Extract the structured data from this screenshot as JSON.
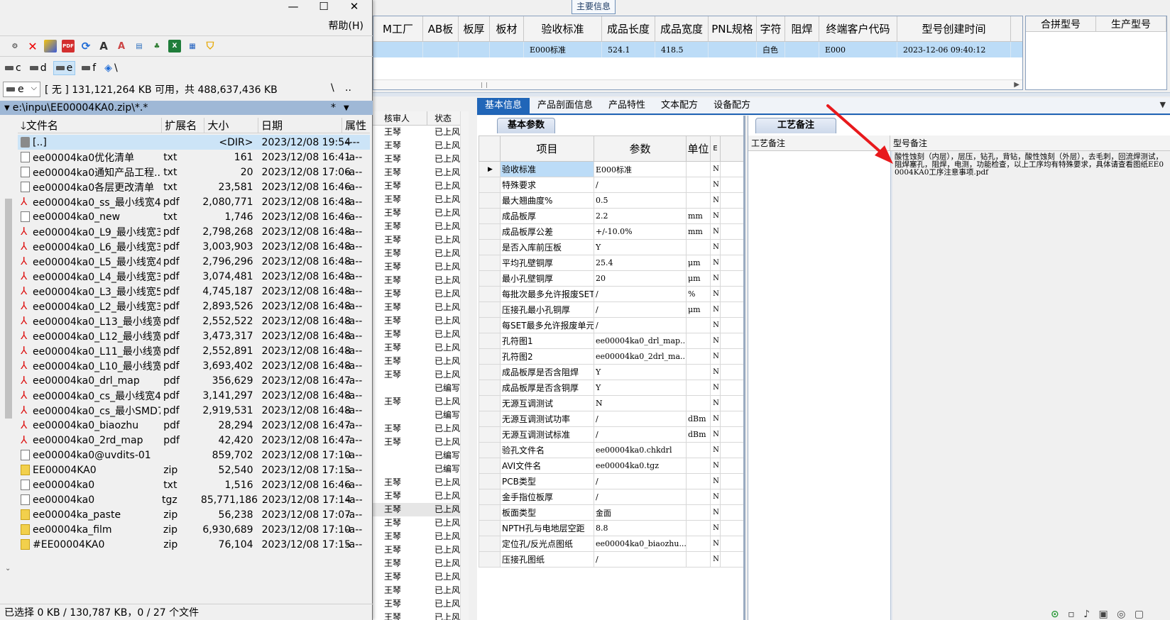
{
  "erp": {
    "main_info_tab": "主要信息",
    "top_grid": {
      "headers": [
        "M工厂",
        "AB板",
        "板厚",
        "板材",
        "验收标准",
        "成品长度",
        "成品宽度",
        "PNL规格",
        "字符",
        "阻焊",
        "终端客户代码",
        "型号创建时间"
      ],
      "row": [
        "",
        "",
        "",
        "",
        "E000标准",
        "524.1",
        "418.5",
        "",
        "白色",
        "",
        "E000",
        "2023-12-06 09:40:12"
      ]
    },
    "merge_grid": {
      "headers": [
        "合拼型号",
        "生产型号"
      ]
    },
    "reviewer_grid": {
      "headers": [
        "核审人",
        "状态"
      ],
      "rows": [
        [
          "王琴",
          "已上风"
        ],
        [
          "王琴",
          "已上风"
        ],
        [
          "王琴",
          "已上风"
        ],
        [
          "王琴",
          "已上风"
        ],
        [
          "王琴",
          "已上风"
        ],
        [
          "王琴",
          "已上风"
        ],
        [
          "王琴",
          "已上风"
        ],
        [
          "王琴",
          "已上风"
        ],
        [
          "王琴",
          "已上风"
        ],
        [
          "王琴",
          "已上风"
        ],
        [
          "王琴",
          "已上风"
        ],
        [
          "王琴",
          "已上风"
        ],
        [
          "王琴",
          "已上风"
        ],
        [
          "王琴",
          "已上风"
        ],
        [
          "王琴",
          "已上风"
        ],
        [
          "王琴",
          "已上风"
        ],
        [
          "王琴",
          "已上风"
        ],
        [
          "王琴",
          "已上风"
        ],
        [
          "王琴",
          "已上风"
        ],
        [
          "",
          "已编写"
        ],
        [
          "王琴",
          "已上风"
        ],
        [
          "",
          "已编写"
        ],
        [
          "王琴",
          "已上风"
        ],
        [
          "王琴",
          "已上风"
        ],
        [
          "",
          "已编写"
        ],
        [
          "",
          "已编写"
        ],
        [
          "王琴",
          "已上风"
        ],
        [
          "王琴",
          "已上风"
        ],
        [
          "王琴",
          "已上风"
        ],
        [
          "王琴",
          "已上风"
        ],
        [
          "王琴",
          "已上风"
        ],
        [
          "王琴",
          "已上风"
        ],
        [
          "王琴",
          "已上风"
        ],
        [
          "王琴",
          "已上风"
        ],
        [
          "王琴",
          "已上风"
        ],
        [
          "王琴",
          "已上风"
        ],
        [
          "王琴",
          "已上风"
        ]
      ]
    },
    "tabs": [
      "基本信息",
      "产品剖面信息",
      "产品特性",
      "文本配方",
      "设备配方"
    ],
    "basic_subtab": "基本参数",
    "param_headers": [
      "项目",
      "参数",
      "单位",
      "E"
    ],
    "params": [
      {
        "item": "验收标准",
        "value": "E000标准",
        "unit": "",
        "flag": "N"
      },
      {
        "item": "特殊要求",
        "value": "/",
        "unit": "",
        "flag": "N"
      },
      {
        "item": "最大翘曲度%",
        "value": "0.5",
        "unit": "",
        "flag": "N"
      },
      {
        "item": "成品板厚",
        "value": "2.2",
        "unit": "mm",
        "flag": "N"
      },
      {
        "item": "成品板厚公差",
        "value": "+/-10.0%",
        "unit": "mm",
        "flag": "N"
      },
      {
        "item": "是否入库前压板",
        "value": "Y",
        "unit": "",
        "flag": "N"
      },
      {
        "item": "平均孔壁铜厚",
        "value": "25.4",
        "unit": "μm",
        "flag": "N"
      },
      {
        "item": "最小孔壁铜厚",
        "value": "20",
        "unit": "μm",
        "flag": "N"
      },
      {
        "item": "每批次最多允许报废SET",
        "value": "/",
        "unit": "%",
        "flag": "N"
      },
      {
        "item": "压接孔最小孔铜厚",
        "value": "/",
        "unit": "μm",
        "flag": "N"
      },
      {
        "item": "每SET最多允许报废单元",
        "value": "/",
        "unit": "",
        "flag": "N"
      },
      {
        "item": "孔符图1",
        "value": "ee00004ka0_drl_map...",
        "unit": "",
        "flag": "N"
      },
      {
        "item": "孔符图2",
        "value": "ee00004ka0_2drl_ma...",
        "unit": "",
        "flag": "N"
      },
      {
        "item": "成品板厚是否含阻焊",
        "value": "Y",
        "unit": "",
        "flag": "N"
      },
      {
        "item": "成品板厚是否含铜厚",
        "value": "Y",
        "unit": "",
        "flag": "N"
      },
      {
        "item": "无源互调测试",
        "value": "N",
        "unit": "",
        "flag": "N"
      },
      {
        "item": "无源互调测试功率",
        "value": "/",
        "unit": "dBm",
        "flag": "N"
      },
      {
        "item": "无源互调测试标准",
        "value": "/",
        "unit": "dBm",
        "flag": "N"
      },
      {
        "item": "验孔文件名",
        "value": "ee00004ka0.chkdrl",
        "unit": "",
        "flag": "N"
      },
      {
        "item": "AVI文件名",
        "value": "ee00004ka0.tgz",
        "unit": "",
        "flag": "N"
      },
      {
        "item": "PCB类型",
        "value": "/",
        "unit": "",
        "flag": "N"
      },
      {
        "item": "金手指位板厚",
        "value": "/",
        "unit": "",
        "flag": "N"
      },
      {
        "item": "板面类型",
        "value": "金面",
        "unit": "",
        "flag": "N"
      },
      {
        "item": "NPTH孔与电地层空距",
        "value": "8.8",
        "unit": "",
        "flag": "N"
      },
      {
        "item": "定位孔/反光点图纸",
        "value": "ee00004ka0_biaozhu...",
        "unit": "",
        "flag": "N"
      },
      {
        "item": "压接孔图纸",
        "value": "/",
        "unit": "",
        "flag": "N"
      }
    ],
    "craft_subtab": "工艺备注",
    "craft_headers": [
      "工艺备注",
      "型号备注"
    ],
    "model_note": "酸性蚀刻（内层），层压，钻孔，背钻，酸性蚀刻（外层），去毛刺，回流焊测试，阻焊塞孔，阻焊，电测，功能检查，以上工序均有特殊要求，具体请查看图纸EE00004KA0工序注意事项.pdf",
    "arrow_color": "#e8191c"
  },
  "tc": {
    "menu_help": "帮助(H)",
    "drives": [
      "c",
      "d",
      "e",
      "f"
    ],
    "root_symbol": "\\",
    "drive_current": "e",
    "free_space": "[ 无 ]  131,121,264 KB 可用，共 488,637,436 KB",
    "nav_root": "\\",
    "nav_up": "..",
    "nav_star": "*",
    "current_path": "e:\\inpu\\EE00004KA0.zip\\*.*",
    "columns": [
      "文件名",
      "扩展名",
      "大小",
      "日期",
      "属性"
    ],
    "files": [
      {
        "name": "[..]",
        "ext": "",
        "size": "<DIR>",
        "date": "2023/12/08 19:54",
        "attr": "----",
        "icon": "up"
      },
      {
        "name": "ee00004ka0优化清单",
        "ext": "txt",
        "size": "161",
        "date": "2023/12/08 16:41",
        "attr": "-a--",
        "icon": "doc"
      },
      {
        "name": "ee00004ka0通知产品工程...",
        "ext": "txt",
        "size": "20",
        "date": "2023/12/08 17:06",
        "attr": "-a--",
        "icon": "doc"
      },
      {
        "name": "ee00004ka0各层更改清单",
        "ext": "txt",
        "size": "23,581",
        "date": "2023/12/08 16:46",
        "attr": "-a--",
        "icon": "doc"
      },
      {
        "name": "ee00004ka0_ss_最小线宽4...",
        "ext": "pdf",
        "size": "2,080,771",
        "date": "2023/12/08 16:48",
        "attr": "-a--",
        "icon": "pdf"
      },
      {
        "name": "ee00004ka0_new",
        "ext": "txt",
        "size": "1,746",
        "date": "2023/12/08 16:46",
        "attr": "-a--",
        "icon": "doc"
      },
      {
        "name": "ee00004ka0_L9_最小线宽3...",
        "ext": "pdf",
        "size": "2,798,268",
        "date": "2023/12/08 16:48",
        "attr": "-a--",
        "icon": "pdf"
      },
      {
        "name": "ee00004ka0_L6_最小线宽3...",
        "ext": "pdf",
        "size": "3,003,903",
        "date": "2023/12/08 16:48",
        "attr": "-a--",
        "icon": "pdf"
      },
      {
        "name": "ee00004ka0_L5_最小线宽4...",
        "ext": "pdf",
        "size": "2,796,296",
        "date": "2023/12/08 16:48",
        "attr": "-a--",
        "icon": "pdf"
      },
      {
        "name": "ee00004ka0_L4_最小线宽3...",
        "ext": "pdf",
        "size": "3,074,481",
        "date": "2023/12/08 16:48",
        "attr": "-a--",
        "icon": "pdf"
      },
      {
        "name": "ee00004ka0_L3_最小线宽5...",
        "ext": "pdf",
        "size": "4,745,187",
        "date": "2023/12/08 16:48",
        "attr": "-a--",
        "icon": "pdf"
      },
      {
        "name": "ee00004ka0_L2_最小线宽3...",
        "ext": "pdf",
        "size": "2,893,526",
        "date": "2023/12/08 16:48",
        "attr": "-a--",
        "icon": "pdf"
      },
      {
        "name": "ee00004ka0_L13_最小线宽...",
        "ext": "pdf",
        "size": "2,552,522",
        "date": "2023/12/08 16:48",
        "attr": "-a--",
        "icon": "pdf"
      },
      {
        "name": "ee00004ka0_L12_最小线宽...",
        "ext": "pdf",
        "size": "3,473,317",
        "date": "2023/12/08 16:48",
        "attr": "-a--",
        "icon": "pdf"
      },
      {
        "name": "ee00004ka0_L11_最小线宽...",
        "ext": "pdf",
        "size": "2,552,891",
        "date": "2023/12/08 16:48",
        "attr": "-a--",
        "icon": "pdf"
      },
      {
        "name": "ee00004ka0_L10_最小线宽...",
        "ext": "pdf",
        "size": "3,693,402",
        "date": "2023/12/08 16:48",
        "attr": "-a--",
        "icon": "pdf"
      },
      {
        "name": "ee00004ka0_drl_map",
        "ext": "pdf",
        "size": "356,629",
        "date": "2023/12/08 16:47",
        "attr": "-a--",
        "icon": "pdf"
      },
      {
        "name": "ee00004ka0_cs_最小线宽4...",
        "ext": "pdf",
        "size": "3,141,297",
        "date": "2023/12/08 16:48",
        "attr": "-a--",
        "icon": "pdf"
      },
      {
        "name": "ee00004ka0_cs_最小SMD7...",
        "ext": "pdf",
        "size": "2,919,531",
        "date": "2023/12/08 16:48",
        "attr": "-a--",
        "icon": "pdf"
      },
      {
        "name": "ee00004ka0_biaozhu",
        "ext": "pdf",
        "size": "28,294",
        "date": "2023/12/08 16:47",
        "attr": "-a--",
        "icon": "pdf"
      },
      {
        "name": "ee00004ka0_2rd_map",
        "ext": "pdf",
        "size": "42,420",
        "date": "2023/12/08 16:47",
        "attr": "-a--",
        "icon": "pdf"
      },
      {
        "name": "ee00004ka0@uvdits-01",
        "ext": "",
        "size": "859,702",
        "date": "2023/12/08 17:10",
        "attr": "-a--",
        "icon": "doc"
      },
      {
        "name": "EE00004KA0",
        "ext": "zip",
        "size": "52,540",
        "date": "2023/12/08 17:15",
        "attr": "-a--",
        "icon": "zip"
      },
      {
        "name": "ee00004ka0",
        "ext": "txt",
        "size": "1,516",
        "date": "2023/12/08 16:46",
        "attr": "-a--",
        "icon": "doc"
      },
      {
        "name": "ee00004ka0",
        "ext": "tgz",
        "size": "85,771,186",
        "date": "2023/12/08 17:14",
        "attr": "-a--",
        "icon": "doc"
      },
      {
        "name": "ee00004ka_paste",
        "ext": "zip",
        "size": "56,238",
        "date": "2023/12/08 17:07",
        "attr": "-a--",
        "icon": "zip"
      },
      {
        "name": "ee00004ka_film",
        "ext": "zip",
        "size": "6,930,689",
        "date": "2023/12/08 17:10",
        "attr": "-a--",
        "icon": "zip"
      },
      {
        "name": "#EE00004KA0",
        "ext": "zip",
        "size": "76,104",
        "date": "2023/12/08 17:15",
        "attr": "-a--",
        "icon": "zip"
      }
    ],
    "status": "已选择 0 KB / 130,787 KB，0 / 27 个文件"
  }
}
